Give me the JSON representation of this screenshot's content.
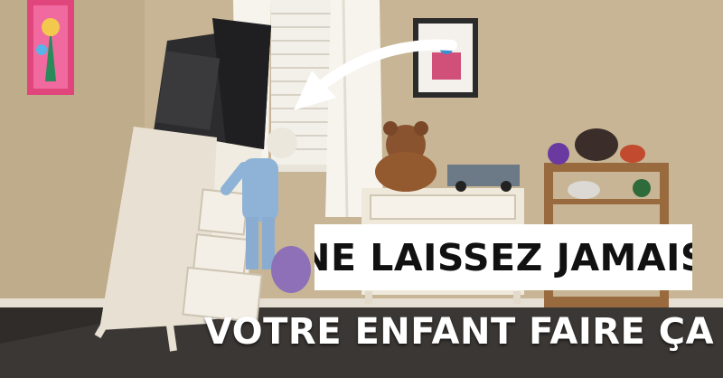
{
  "caption": {
    "line1": "NE LAISSEZ JAMAIS",
    "line2": "VOTRE ENFANT FAIRE ÇA"
  },
  "colors": {
    "wall": "#c9b89a",
    "floor": "#3a3633",
    "caption_box": "#ffffff",
    "arrow": "#ffffff"
  }
}
